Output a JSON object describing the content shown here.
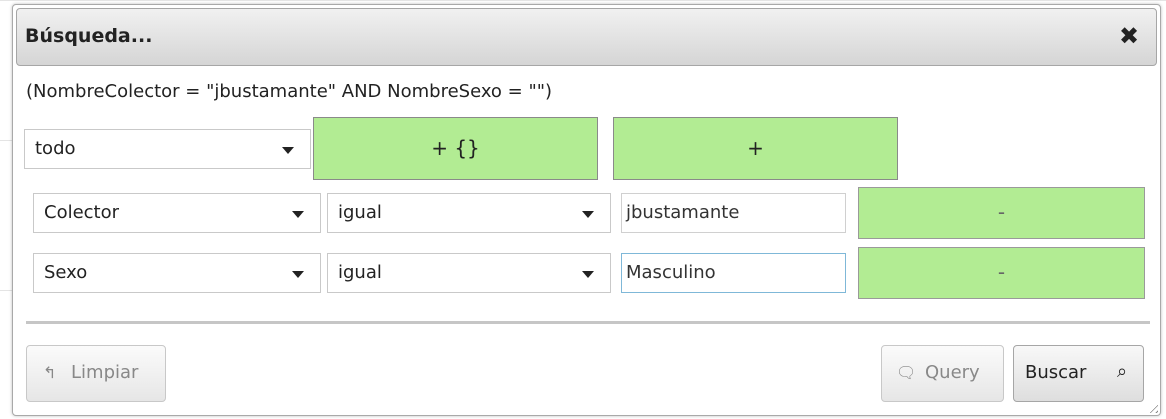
{
  "dialog": {
    "title": "Búsqueda...",
    "close_icon": "close-icon",
    "query_expression": "(NombreColector = \"jbustamante\" AND NombreSexo = \"\")"
  },
  "group": {
    "match_select": "todo",
    "add_group_label": "+ {}",
    "add_rule_label": "+"
  },
  "rules": [
    {
      "field": "Colector",
      "operator": "igual",
      "value": "jbustamante",
      "remove_label": "-"
    },
    {
      "field": "Sexo",
      "operator": "igual",
      "value": "Masculino",
      "remove_label": "-"
    }
  ],
  "footer": {
    "clear_label": "Limpiar",
    "clear_icon": "undo-icon",
    "query_label": "Query",
    "query_icon": "comment-icon",
    "search_label": "Buscar",
    "search_icon": "search-icon"
  },
  "colors": {
    "button_green": "#b2ec93",
    "focus_border": "#7fb8d8"
  }
}
